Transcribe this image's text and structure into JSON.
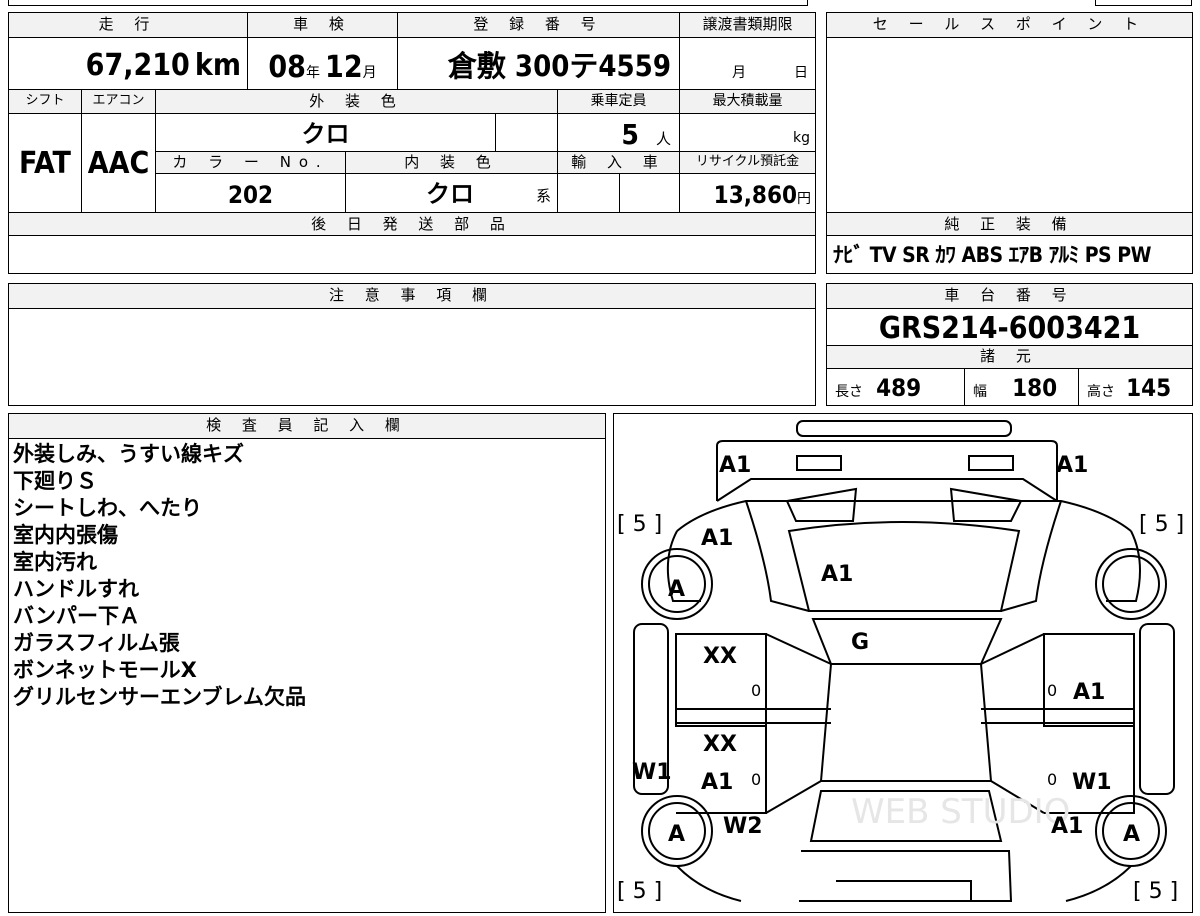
{
  "top_table": {
    "headers": {
      "mileage": "走 行",
      "shaken": "車 検",
      "registration": "登 録 番 号",
      "transfer_deadline": "譲渡書類期限",
      "shift": "シフト",
      "aircon": "エアコン",
      "exterior_color": "外 装 色",
      "capacity": "乗車定員",
      "max_load": "最大積載量",
      "color_no": "カ ラ ー No.",
      "interior_color": "内 装 色",
      "import": "輸 入 車",
      "recycle": "リサイクル預託金",
      "later_parts": "後 日 発 送 部 品"
    },
    "values": {
      "mileage_num": "67,210",
      "mileage_unit": "km",
      "shaken_year": "08",
      "shaken_year_unit": "年",
      "shaken_month": "12",
      "shaken_month_unit": "月",
      "registration": "倉敷 300テ4559",
      "transfer_month": "月",
      "transfer_day": "日",
      "shift": "FAT",
      "aircon": "AAC",
      "exterior_color": "クロ",
      "capacity": "5",
      "capacity_unit": "人",
      "max_load_unit": "kg",
      "color_no": "202",
      "interior_color": "クロ",
      "interior_suffix": "系",
      "recycle": "13,860",
      "recycle_unit": "円"
    }
  },
  "sales_point": {
    "header": "セ ー ル ス ポ イ ン ト"
  },
  "equipment": {
    "header": "純 正 装 備",
    "items": "ﾅﾋﾞ TV SR ｶﾜ ABS ｴｱB ｱﾙﾐ PS PW"
  },
  "notes_section": {
    "header": "注 意 事 項 欄"
  },
  "chassis": {
    "header": "車 台 番 号",
    "number": "GRS214-6003421"
  },
  "specs": {
    "header": "諸 元",
    "length_label": "長さ",
    "length": "489",
    "width_label": "幅",
    "width": "180",
    "height_label": "高さ",
    "height": "145"
  },
  "inspector": {
    "header": "検 査 員 記 入 欄",
    "lines": [
      "外装しみ、うすい線キズ",
      "下廻りＳ",
      "シートしわ、へたり",
      "室内内張傷",
      "室内汚れ",
      "ハンドルすれ",
      "バンパー下Ａ",
      "ガラスフィルム張",
      "ボンネットモールX",
      "グリルセンサーエンブレム欠品"
    ]
  },
  "diagram": {
    "marks": {
      "front_left": "A1",
      "front_right": "A1",
      "tire_fl": "[ 5 ]",
      "tire_fr": "[ 5 ]",
      "tire_rl": "[ 5 ]",
      "tire_rr": "[ 5 ]",
      "fender_fl": "A1",
      "hood": "A1",
      "wheel_fl": "A",
      "wheel_rl": "A",
      "wheel_rr": "A",
      "windshield": "G",
      "door_fl": "XX",
      "door_rl_1": "XX",
      "door_rl_2": "A1",
      "door_fr": "A1",
      "door_rr": "W1",
      "sill_l": "W1",
      "rear_fender_l": "W2",
      "rear_fender_r": "A1",
      "zero": "0"
    },
    "watermark": "WEB STUDIO"
  }
}
